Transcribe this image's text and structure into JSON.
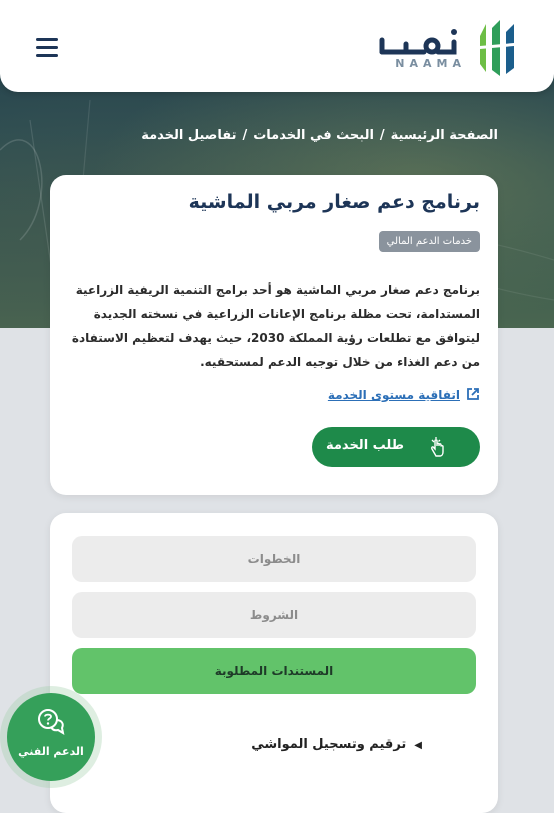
{
  "header": {
    "logo_text": "NAAMA",
    "logo_arabic": "نمــا"
  },
  "breadcrumb": {
    "items": [
      "الصفحة الرئيسية",
      "البحث في الخدمات",
      "تفاصيل الخدمة"
    ],
    "separator": "/"
  },
  "service": {
    "title": "برنامج دعم صغار مربي الماشية",
    "badge": "خدمات الدعم المالي",
    "description": "برنامج دعم صغار مربي الماشية هو أحد برامج التنمية الريفية الزراعية المستدامة، تحت مظلة برنامج الإعانات الزراعية في نسخته الجديدة ليتوافق مع تطلعات رؤية المملكة 2030، حيث يهدف لتعظيم الاستفادة من دعم الغذاء من خلال توجيه الدعم لمستحقيه.",
    "sla_link": "اتفاقية مستوى الخدمة",
    "apply_label": "طلب الخدمة"
  },
  "details": {
    "steps_label": "الخطوات",
    "conditions_label": "الشروط",
    "documents_label": "المستندات المطلوبة",
    "document_items": [
      "ترقيم وتسجيل المواشي"
    ]
  },
  "support": {
    "label": "الدعم الفني"
  },
  "colors": {
    "primary_green": "#1e8a4a",
    "accent_green": "#62c36a",
    "navy": "#1d3557",
    "link_blue": "#2c6fb7"
  }
}
